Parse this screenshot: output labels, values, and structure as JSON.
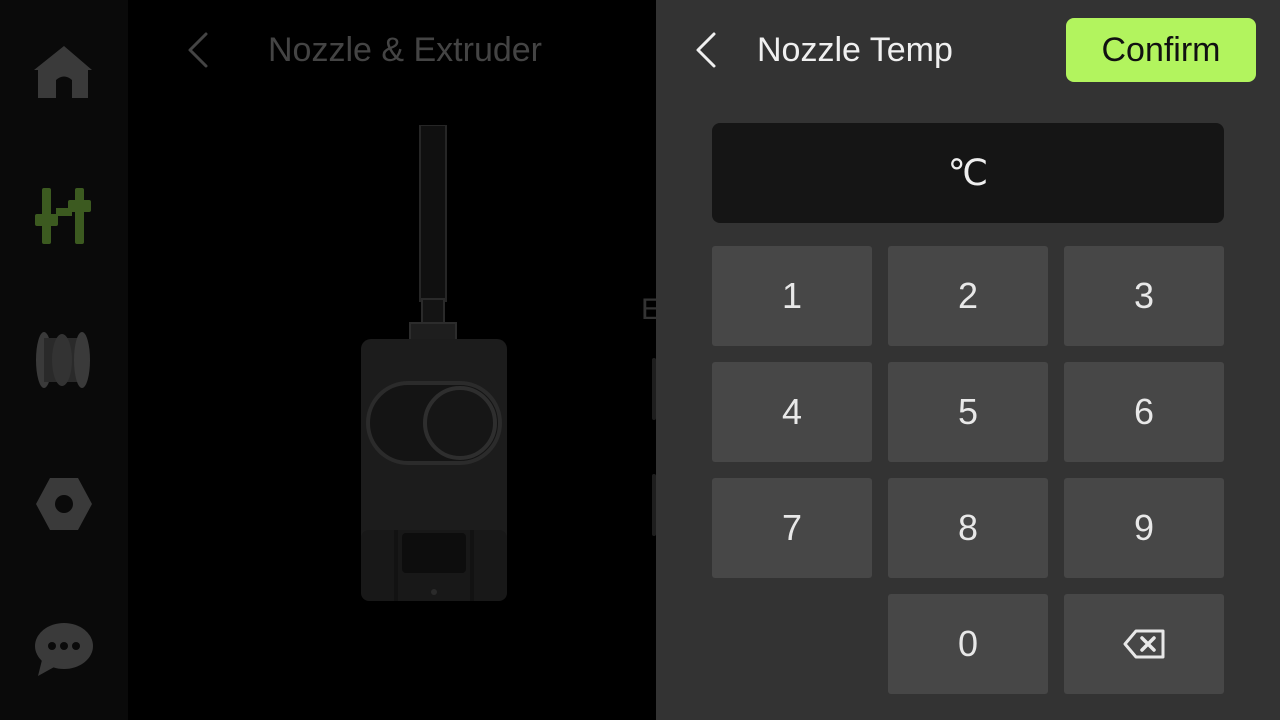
{
  "colors": {
    "accent": "#b2f45e",
    "panel_bg": "#333333",
    "key_bg": "#474747",
    "display_bg": "#151515",
    "sidebar_active_icon": "#3c5a20"
  },
  "sidebar": {
    "items": [
      {
        "icon": "home-icon"
      },
      {
        "icon": "controls-sliders-icon",
        "active": true
      },
      {
        "icon": "filament-spool-icon"
      },
      {
        "icon": "settings-nut-icon"
      },
      {
        "icon": "chat-bubble-icon"
      }
    ]
  },
  "background_screen": {
    "title": "Nozzle & Extruder",
    "partial_label": "E"
  },
  "keypad_panel": {
    "title": "Nozzle Temp",
    "confirm_label": "Confirm",
    "display": {
      "value": "",
      "unit": "℃"
    },
    "keys": [
      "1",
      "2",
      "3",
      "4",
      "5",
      "6",
      "7",
      "8",
      "9",
      "0"
    ],
    "backspace_icon": "backspace-icon"
  }
}
